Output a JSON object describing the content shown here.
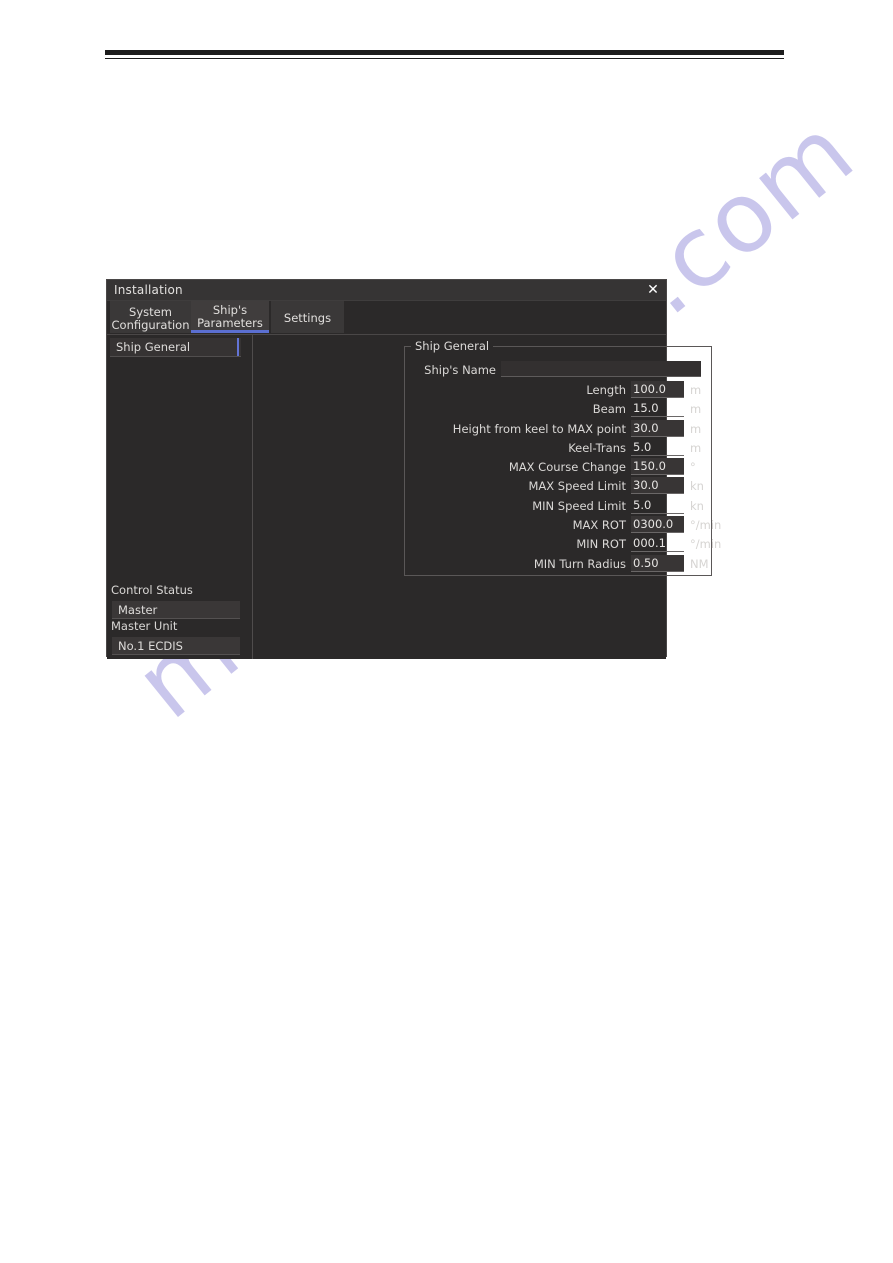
{
  "watermark": {
    "text": "manualshive.com",
    "color": "#c9c6ec"
  },
  "dialog": {
    "title": "Installation",
    "close_icon": "close-icon",
    "close_glyph": "✕",
    "accent_color": "#5b6fd1",
    "tabs": [
      {
        "id": "system-configuration",
        "line1": "System",
        "line2": "Configuration",
        "active": false
      },
      {
        "id": "ships-parameters",
        "line1": "Ship's",
        "line2": "Parameters",
        "active": true
      },
      {
        "id": "settings",
        "line1": "Settings",
        "line2": "",
        "active": true
      }
    ],
    "sidebar": {
      "items": [
        {
          "label": "Ship General",
          "selected": true
        }
      ],
      "control_status": {
        "status_label": "Control Status",
        "status_value": "Master",
        "unit_label": "Master Unit",
        "unit_value": "No.1 ECDIS"
      }
    },
    "main": {
      "group_title": "Ship General",
      "ship_name": {
        "label": "Ship's Name",
        "value": "",
        "placeholder": ""
      },
      "fields": [
        {
          "label": "Length",
          "value": "100.0",
          "unit": "m",
          "editable": true
        },
        {
          "label": "Beam",
          "value": "15.0",
          "unit": "m",
          "editable": false
        },
        {
          "label": "Height from keel to MAX point",
          "value": "30.0",
          "unit": "m",
          "editable": true
        },
        {
          "label": "Keel-Trans",
          "value": "5.0",
          "unit": "m",
          "editable": false
        },
        {
          "label": "MAX Course Change",
          "value": "150.0",
          "unit": "°",
          "editable": true
        },
        {
          "label": "MAX Speed Limit",
          "value": "30.0",
          "unit": "kn",
          "editable": true
        },
        {
          "label": "MIN Speed Limit",
          "value": "5.0",
          "unit": "kn",
          "editable": false
        },
        {
          "label": "MAX ROT",
          "value": "0300.0",
          "unit": "°/min",
          "editable": true
        },
        {
          "label": "MIN ROT",
          "value": "000.1",
          "unit": "°/min",
          "editable": false
        },
        {
          "label": "MIN Turn Radius",
          "value": "0.50",
          "unit": "NM",
          "editable": true
        }
      ]
    }
  }
}
